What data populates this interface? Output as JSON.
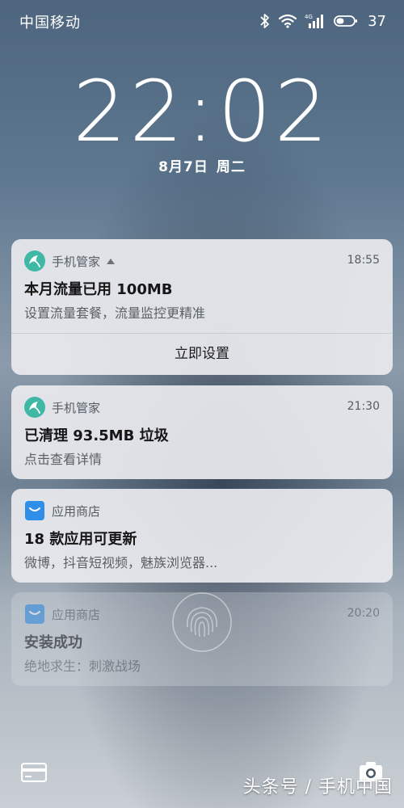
{
  "status_bar": {
    "carrier": "中国移动",
    "network_type": "4G",
    "battery_level": "37",
    "icons": [
      "bluetooth-icon",
      "wifi-icon",
      "signal-icon",
      "battery-icon"
    ]
  },
  "lock_screen": {
    "time": "22:02",
    "date": "8月7日",
    "weekday": "周二"
  },
  "notifications": [
    {
      "app_name": "手机管家",
      "time": "18:55",
      "title": "本月流量已用 100MB",
      "body": "设置流量套餐，流量监控更精准",
      "action_label": "立即设置",
      "icon": "phone-manager-icon",
      "expanded": true
    },
    {
      "app_name": "手机管家",
      "time": "21:30",
      "title": "已清理 93.5MB 垃圾",
      "body": "点击查看详情",
      "icon": "phone-manager-icon"
    },
    {
      "app_name": "应用商店",
      "time": "",
      "title": "18 款应用可更新",
      "body": "微博，抖音短视频，魅族浏览器...",
      "icon": "app-store-icon"
    },
    {
      "app_name": "应用商店",
      "time": "20:20",
      "title": "安装成功",
      "body": "绝地求生：刺激战场",
      "icon": "app-store-icon"
    }
  ],
  "bottom_bar": {
    "left_icon": "wallet-icon",
    "right_icon": "camera-icon",
    "watermark": "头条号 / 手机中国"
  },
  "colors": {
    "phone_manager_accent": "#3fb8a6",
    "app_store_accent": "#2f8ee8",
    "card_background": "#e8eaee"
  }
}
